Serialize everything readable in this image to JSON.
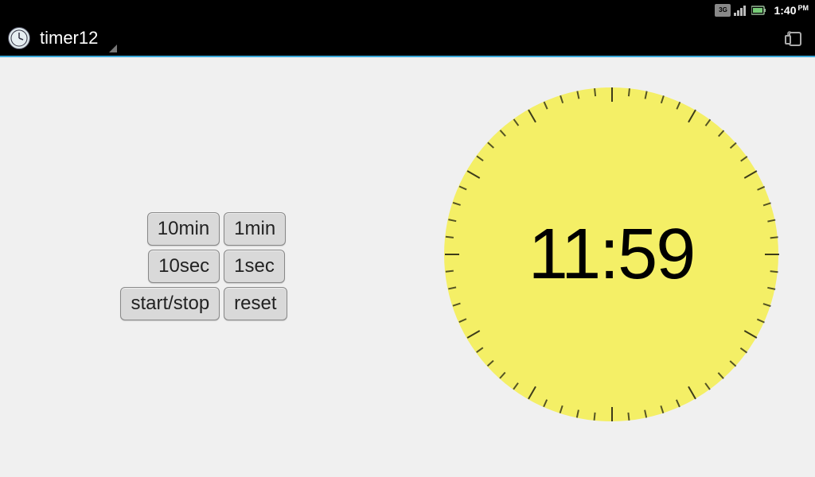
{
  "status": {
    "network_label": "3G",
    "time": "1:40",
    "time_period": "PM"
  },
  "titlebar": {
    "app_name": "timer12"
  },
  "buttons": {
    "ten_min": "10min",
    "one_min": "1min",
    "ten_sec": "10sec",
    "one_sec": "1sec",
    "start_stop": "start/stop",
    "reset": "reset"
  },
  "timer": {
    "display": "11:59"
  },
  "colors": {
    "clock_face": "#f4ef66",
    "title_accent": "#3aa7d8"
  }
}
